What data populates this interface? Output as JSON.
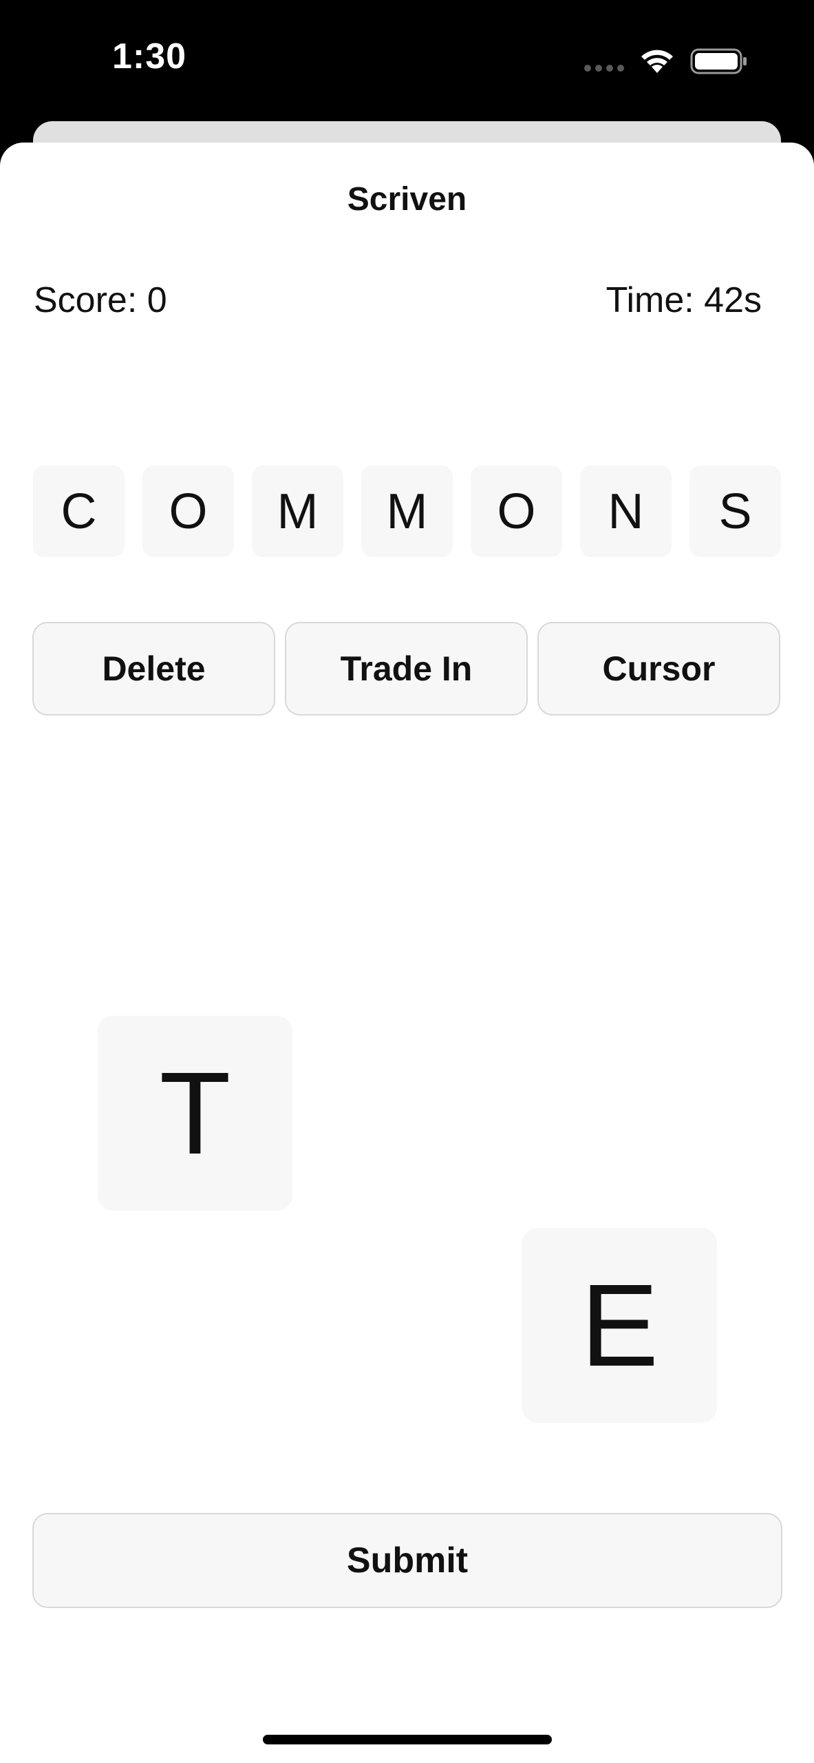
{
  "status_bar": {
    "time": "1:30"
  },
  "icons": {
    "signal": "cellular-signal-icon",
    "wifi": "wifi-icon",
    "battery": "battery-icon"
  },
  "nav": {
    "title": "Scriven"
  },
  "stats": {
    "score": "Score: 0",
    "time": "Time: 42s"
  },
  "word_tiles": [
    "C",
    "O",
    "M",
    "M",
    "O",
    "N",
    "S"
  ],
  "actions": {
    "delete": "Delete",
    "trade_in": "Trade In",
    "cursor": "Cursor"
  },
  "floating_tiles": {
    "first": "T",
    "second": "E"
  },
  "submit": "Submit",
  "colors": {
    "tile_background": "#f7f7f7",
    "button_border": "#d8d8d8",
    "text": "#111111"
  }
}
